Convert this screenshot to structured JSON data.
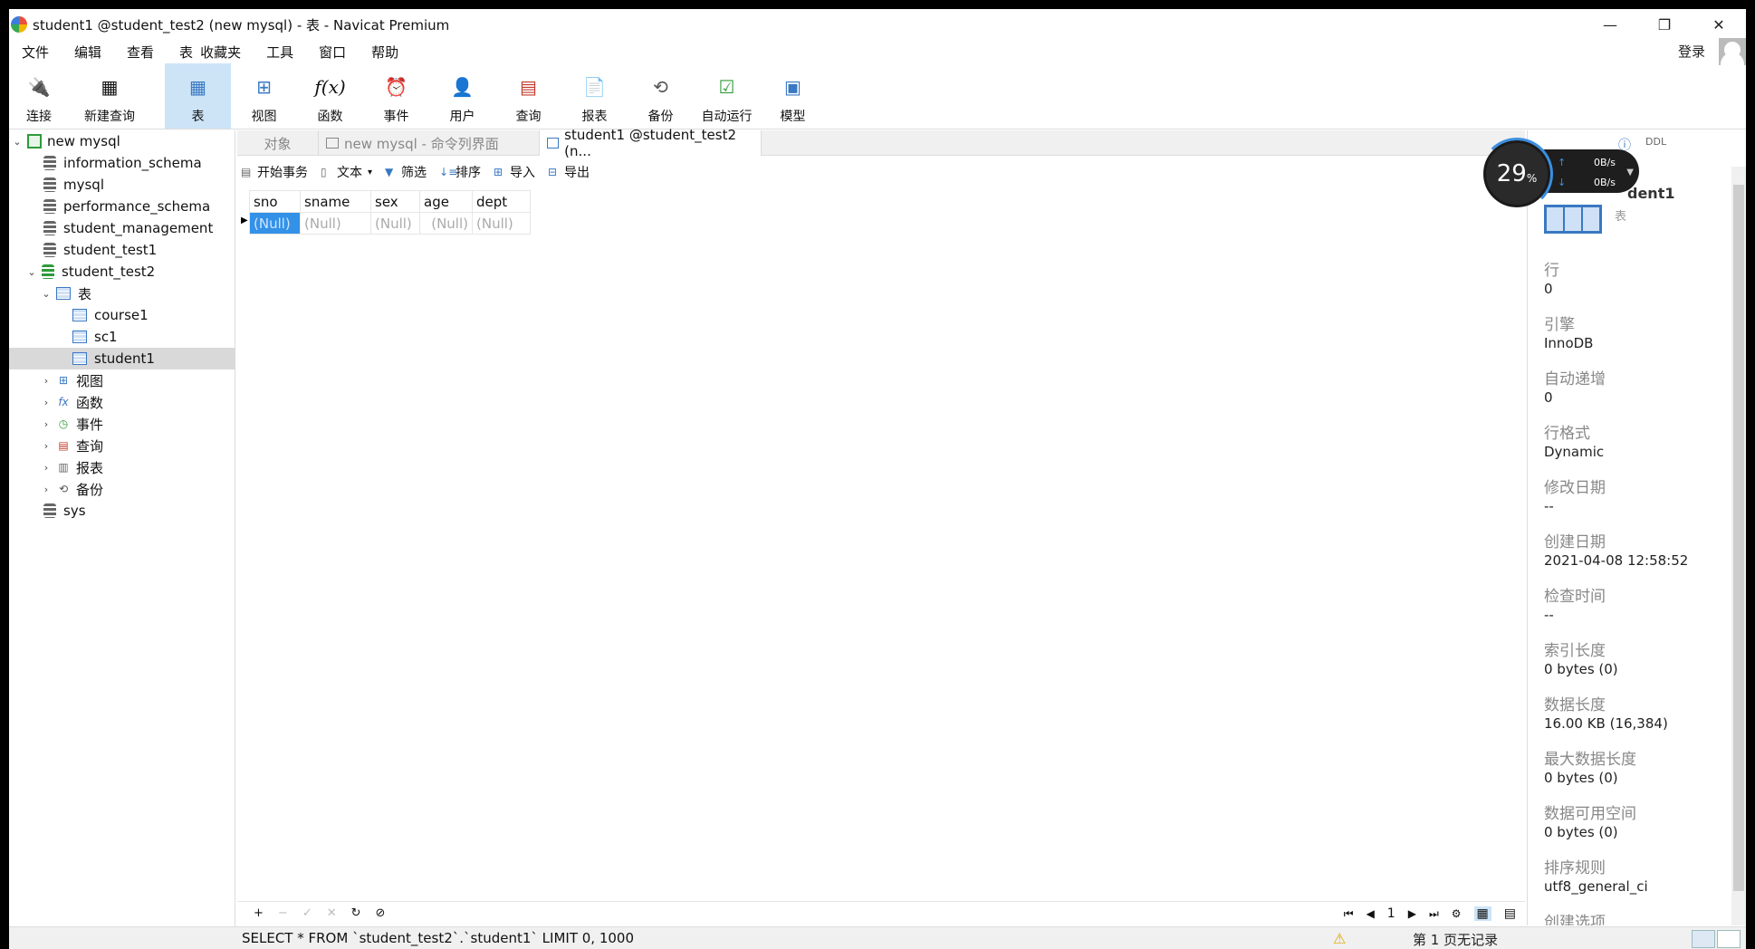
{
  "window": {
    "title": "student1 @student_test2 (new mysql) - 表 - Navicat Premium",
    "controls": [
      "—",
      "❐",
      "✕"
    ]
  },
  "menu": {
    "items": [
      "文件",
      "编辑",
      "查看",
      "表",
      "收藏夹",
      "工具",
      "窗口",
      "帮助"
    ],
    "login": "登录"
  },
  "toolbar": {
    "connect": "连接",
    "new_query": "新建查询",
    "table": "表",
    "view": "视图",
    "function": "函数",
    "event": "事件",
    "user": "用户",
    "query": "查询",
    "report": "报表",
    "backup": "备份",
    "automation": "自动运行",
    "model": "模型"
  },
  "tree": {
    "connection": "new mysql",
    "databases": [
      "information_schema",
      "mysql",
      "performance_schema",
      "student_management",
      "student_test1"
    ],
    "active_db": "student_test2",
    "tables_group": "表",
    "tables": [
      "course1",
      "sc1",
      "student1"
    ],
    "groups": [
      "视图",
      "函数",
      "事件",
      "查询",
      "报表",
      "备份"
    ],
    "last_db": "sys"
  },
  "tabs": {
    "objects": "对象",
    "command": "new mysql - 命令列界面",
    "current": "student1 @student_test2 (n..."
  },
  "grid_toolbar": {
    "begin_tx": "开始事务",
    "text": "文本",
    "filter": "筛选",
    "sort": "排序",
    "import": "导入",
    "export": "导出"
  },
  "grid": {
    "columns": [
      "sno",
      "sname",
      "sex",
      "age",
      "dept"
    ],
    "row": [
      "(Null)",
      "(Null)",
      "(Null)",
      "(Null)",
      "(Null)"
    ]
  },
  "pager": {
    "page": "1"
  },
  "status": {
    "sql": "SELECT * FROM `student_test2`.`student1` LIMIT 0, 1000",
    "records": "第 1 页无记录"
  },
  "info": {
    "title": "dent1",
    "subtitle": "表",
    "fields": [
      {
        "label": "行",
        "value": "0"
      },
      {
        "label": "引擎",
        "value": "InnoDB"
      },
      {
        "label": "自动递增",
        "value": "0"
      },
      {
        "label": "行格式",
        "value": "Dynamic"
      },
      {
        "label": "修改日期",
        "value": "--"
      },
      {
        "label": "创建日期",
        "value": "2021-04-08 12:58:52"
      },
      {
        "label": "检查时间",
        "value": "--"
      },
      {
        "label": "索引长度",
        "value": "0 bytes (0)"
      },
      {
        "label": "数据长度",
        "value": "16.00 KB (16,384)"
      },
      {
        "label": "最大数据长度",
        "value": "0 bytes (0)"
      },
      {
        "label": "数据可用空间",
        "value": "0 bytes (0)"
      },
      {
        "label": "排序规则",
        "value": "utf8_general_ci"
      },
      {
        "label": "创建选项",
        "value": ""
      }
    ]
  },
  "speed_widget": {
    "percent": "29",
    "percent_sign": "%",
    "up": "0B/s",
    "down": "0B/s"
  }
}
